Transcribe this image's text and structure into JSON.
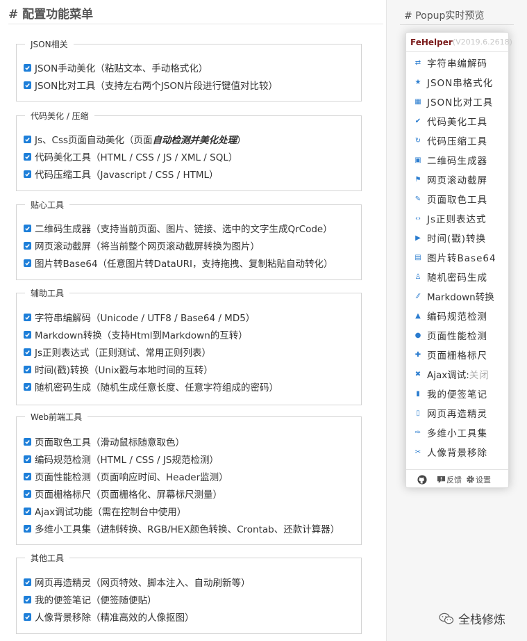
{
  "page": {
    "title": "# 配置功能菜单"
  },
  "groups": [
    {
      "title": "JSON相关",
      "items": [
        {
          "text": "JSON手动美化（粘贴文本、手动格式化）"
        },
        {
          "text": "JSON比对工具（支持左右两个JSON片段进行键值对比较）"
        }
      ]
    },
    {
      "title": "代码美化 / 压缩",
      "items": [
        {
          "text": "Js、Css页面自动美化（页面",
          "em": "自动检测并美化处理",
          "suffix": "）"
        },
        {
          "text": "代码美化工具（HTML / CSS / JS / XML / SQL）"
        },
        {
          "text": "代码压缩工具（Javascript / CSS / HTML）"
        }
      ]
    },
    {
      "title": "贴心工具",
      "items": [
        {
          "text": "二维码生成器（支持当前页面、图片、链接、选中的文字生成QrCode）"
        },
        {
          "text": "网页滚动截屏（将当前整个网页滚动截屏转换为图片）"
        },
        {
          "text": "图片转Base64（任意图片转DataURI，支持拖拽、复制粘贴自动转化）"
        }
      ]
    },
    {
      "title": "辅助工具",
      "items": [
        {
          "text": "字符串编解码（Unicode / UTF8 / Base64 / MD5）"
        },
        {
          "text": "Markdown转换（支持Html到Markdown的互转）"
        },
        {
          "text": "Js正则表达式（正则测试、常用正则列表）"
        },
        {
          "text": "时间(戳)转换（Unix戳与本地时间的互转）"
        },
        {
          "text": "随机密码生成（随机生成任意长度、任意字符组成的密码）"
        }
      ]
    },
    {
      "title": "Web前端工具",
      "items": [
        {
          "text": "页面取色工具（滑动鼠标随意取色）"
        },
        {
          "text": "编码规范检测（HTML / CSS / JS规范检测）"
        },
        {
          "text": "页面性能检测（页面响应时间、Header监测）"
        },
        {
          "text": "页面栅格标尺（页面栅格化、屏幕标尺测量）"
        },
        {
          "text": "Ajax调试功能（需在控制台中使用）"
        },
        {
          "text": "多维小工具集（进制转换、RGB/HEX颜色转换、Crontab、还款计算器）"
        }
      ]
    },
    {
      "title": "其他工具",
      "items": [
        {
          "text": "网页再造精灵（网页特效、脚本注入、自动刷新等）"
        },
        {
          "text": "我的便签笔记（便签随便贴）"
        },
        {
          "text": "人像背景移除（精准高效的人像抠图）"
        }
      ]
    }
  ],
  "preview": {
    "title": "# Popup实时预览",
    "brand": "FeHelper",
    "version": "(V2019.6.2618)",
    "menu": [
      {
        "label": "字符串编解码",
        "icon": "swap-icon",
        "glyph": "⇄"
      },
      {
        "label": "JSON串格式化",
        "icon": "star-icon",
        "glyph": "★"
      },
      {
        "label": "JSON比对工具",
        "icon": "table-icon",
        "glyph": "▦"
      },
      {
        "label": "代码美化工具",
        "icon": "check-icon",
        "glyph": "✔"
      },
      {
        "label": "代码压缩工具",
        "icon": "refresh-icon",
        "glyph": "↻"
      },
      {
        "label": "二维码生成器",
        "icon": "qrcode-icon",
        "glyph": "▣"
      },
      {
        "label": "网页滚动截屏",
        "icon": "flag-icon",
        "glyph": "⚑"
      },
      {
        "label": "页面取色工具",
        "icon": "pencil-icon",
        "glyph": "✎"
      },
      {
        "label": "Js正则表达式",
        "icon": "code-icon",
        "glyph": "‹›"
      },
      {
        "label": "时间(戳)转换",
        "icon": "play-icon",
        "glyph": "▶"
      },
      {
        "label": "图片转Base64",
        "icon": "image-icon",
        "glyph": "▤"
      },
      {
        "label": "随机密码生成",
        "icon": "user-icon",
        "glyph": "♙"
      },
      {
        "label": "Markdown转换",
        "icon": "markdown-icon",
        "glyph": "⁄⁄"
      },
      {
        "label": "编码规范检测",
        "icon": "warning-icon",
        "glyph": "▲"
      },
      {
        "label": "页面性能检测",
        "icon": "clock-icon",
        "glyph": "●"
      },
      {
        "label": "页面栅格标尺",
        "icon": "plus-icon",
        "glyph": "✚"
      },
      {
        "label": "Ajax调试:",
        "sub": "关闭",
        "icon": "close-icon",
        "glyph": "✖"
      },
      {
        "label": "我的便签笔记",
        "icon": "notebook-icon",
        "glyph": "▮"
      },
      {
        "label": "网页再造精灵",
        "icon": "file-icon",
        "glyph": "▯"
      },
      {
        "label": "多维小工具集",
        "icon": "wrench-icon",
        "glyph": "✑"
      },
      {
        "label": "人像背景移除",
        "icon": "scissors-icon",
        "glyph": "✂"
      }
    ],
    "footer": {
      "feedback": "反馈",
      "settings": "设置"
    }
  },
  "watermark": {
    "text": "全栈修炼"
  },
  "colors": {
    "accent": "#1e7fd9",
    "brand": "#7a1a1a"
  }
}
